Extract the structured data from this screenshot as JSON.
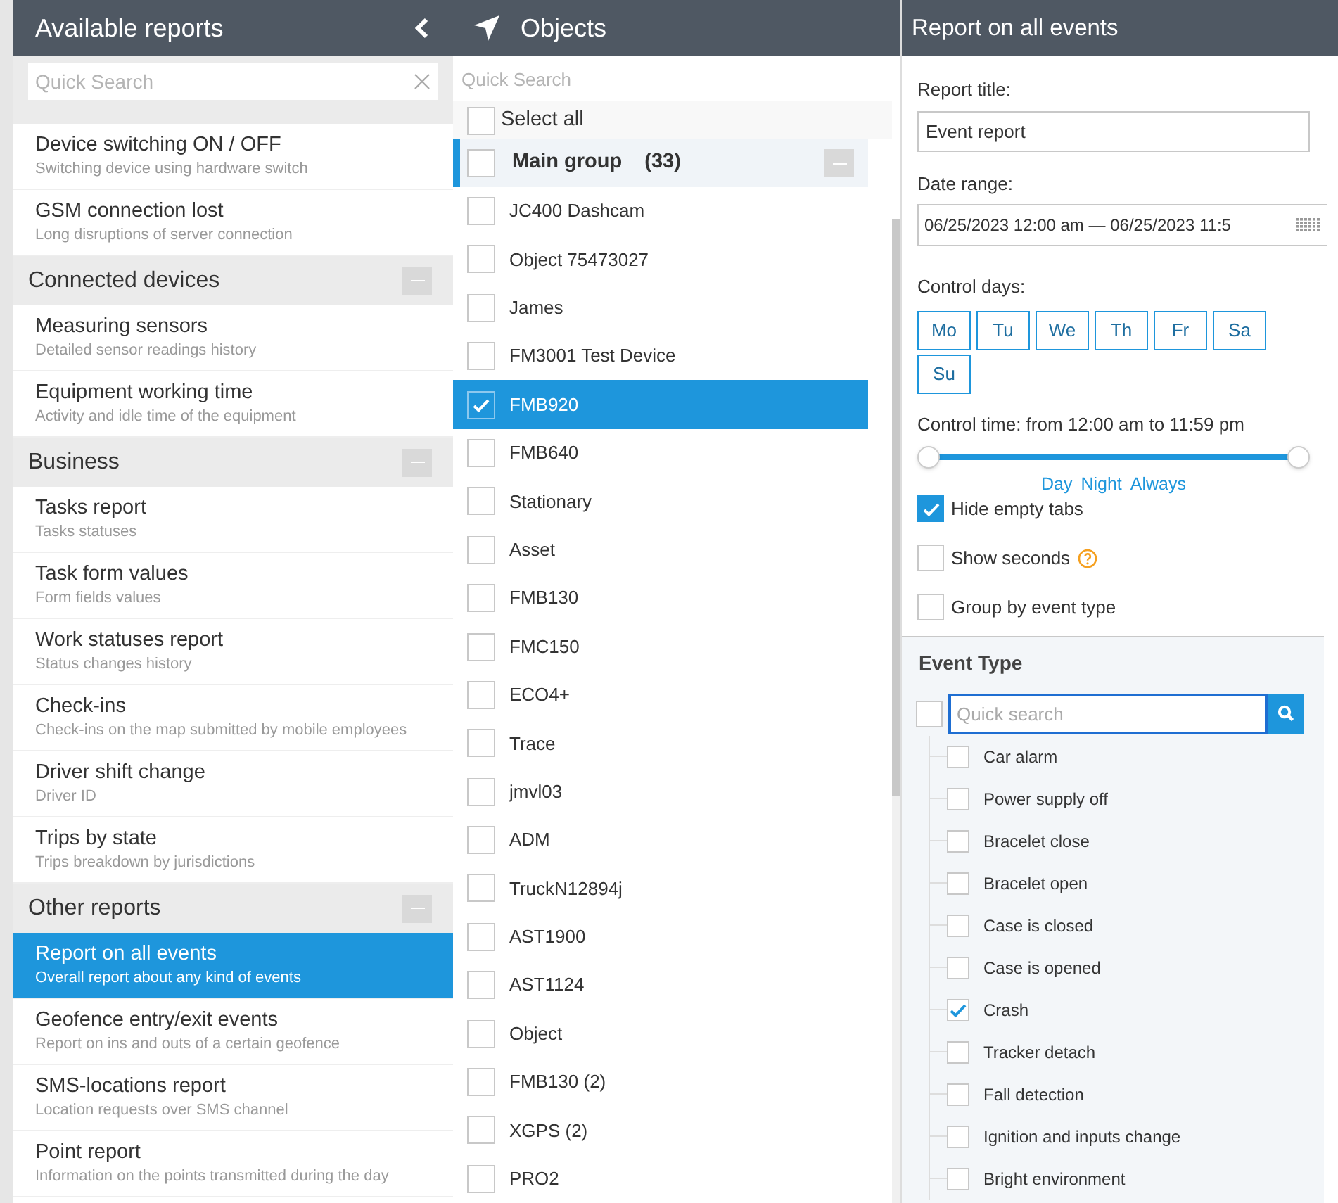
{
  "reports_panel": {
    "title": "Available reports",
    "search": {
      "placeholder": "Quick Search"
    },
    "sections": [
      {
        "items": [
          {
            "title": "Device switching ON / OFF",
            "subtitle": "Switching device using hardware switch",
            "selected": false
          },
          {
            "title": "GSM connection lost",
            "subtitle": "Long disruptions of server connection",
            "selected": false
          }
        ]
      },
      {
        "title": "Connected devices",
        "items": [
          {
            "title": "Measuring sensors",
            "subtitle": "Detailed sensor readings history",
            "selected": false
          },
          {
            "title": "Equipment working time",
            "subtitle": "Activity and idle time of the equipment",
            "selected": false
          }
        ]
      },
      {
        "title": "Business",
        "items": [
          {
            "title": "Tasks report",
            "subtitle": "Tasks statuses",
            "selected": false
          },
          {
            "title": "Task form values",
            "subtitle": "Form fields values",
            "selected": false
          },
          {
            "title": "Work statuses report",
            "subtitle": "Status changes history",
            "selected": false
          },
          {
            "title": "Check-ins",
            "subtitle": "Check-ins on the map submitted by mobile employees",
            "selected": false
          },
          {
            "title": "Driver shift change",
            "subtitle": "Driver ID",
            "selected": false
          },
          {
            "title": "Trips by state",
            "subtitle": "Trips breakdown by jurisdictions",
            "selected": false
          }
        ]
      },
      {
        "title": "Other reports",
        "items": [
          {
            "title": "Report on all events",
            "subtitle": "Overall report about any kind of events",
            "selected": true
          },
          {
            "title": "Geofence entry/exit events",
            "subtitle": "Report on ins and outs of a certain geofence",
            "selected": false
          },
          {
            "title": "SMS-locations report",
            "subtitle": "Location requests over SMS channel",
            "selected": false
          },
          {
            "title": "Point report",
            "subtitle": "Information on the points transmitted during the day",
            "selected": false
          }
        ]
      }
    ]
  },
  "objects_panel": {
    "title": "Objects",
    "search": {
      "placeholder": "Quick Search"
    },
    "select_all": {
      "label": "Select all",
      "checked": false
    },
    "group": {
      "name": "Main group",
      "count": "(33)",
      "checked": false
    },
    "objects": [
      {
        "name": "JC400 Dashcam",
        "checked": false
      },
      {
        "name": "Object 75473027",
        "checked": false
      },
      {
        "name": "James",
        "checked": false
      },
      {
        "name": "FM3001 Test Device",
        "checked": false
      },
      {
        "name": "FMB920",
        "checked": true
      },
      {
        "name": "FMB640",
        "checked": false
      },
      {
        "name": "Stationary",
        "checked": false
      },
      {
        "name": "Asset",
        "checked": false
      },
      {
        "name": "FMB130",
        "checked": false
      },
      {
        "name": "FMC150",
        "checked": false
      },
      {
        "name": "ECO4+",
        "checked": false
      },
      {
        "name": "Trace",
        "checked": false
      },
      {
        "name": "jmvl03",
        "checked": false
      },
      {
        "name": "ADM",
        "checked": false
      },
      {
        "name": "TruckN12894j",
        "checked": false
      },
      {
        "name": "AST1900",
        "checked": false
      },
      {
        "name": "AST1124",
        "checked": false
      },
      {
        "name": "Object",
        "checked": false
      },
      {
        "name": "FMB130 (2)",
        "checked": false
      },
      {
        "name": "XGPS (2)",
        "checked": false
      },
      {
        "name": "PRO2",
        "checked": false
      }
    ]
  },
  "report_panel": {
    "title": "Report on all events",
    "report_title": {
      "label": "Report title:",
      "value": "Event report"
    },
    "date_range": {
      "label": "Date range:",
      "value": "06/25/2023 12:00 am — 06/25/2023 11:5"
    },
    "control_days": {
      "label": "Control days:",
      "days": [
        {
          "label": "Mo",
          "selected": true
        },
        {
          "label": "Tu",
          "selected": true
        },
        {
          "label": "We",
          "selected": true
        },
        {
          "label": "Th",
          "selected": true
        },
        {
          "label": "Fr",
          "selected": true
        },
        {
          "label": "Sa",
          "selected": true
        },
        {
          "label": "Su",
          "selected": true
        }
      ]
    },
    "control_time": {
      "label": "Control time: from 12:00 am to 11:59 pm",
      "handles": [
        {
          "level": 0
        },
        {
          "level": 1
        }
      ],
      "presets": [
        "Day",
        "Night",
        "Always"
      ]
    },
    "options": [
      {
        "label": "Hide empty tabs",
        "checked": true,
        "help": false
      },
      {
        "label": "Show seconds",
        "checked": false,
        "help": true
      },
      {
        "label": "Group by event type",
        "checked": false,
        "help": false
      }
    ],
    "event_type": {
      "title": "Event Type",
      "all_checked": false,
      "search": {
        "placeholder": "Quick search"
      },
      "events": [
        {
          "name": "Car alarm",
          "checked": false
        },
        {
          "name": "Power supply off",
          "checked": false
        },
        {
          "name": "Bracelet close",
          "checked": false
        },
        {
          "name": "Bracelet open",
          "checked": false
        },
        {
          "name": "Case is closed",
          "checked": false
        },
        {
          "name": "Case is opened",
          "checked": false
        },
        {
          "name": "Crash",
          "checked": true
        },
        {
          "name": "Tracker detach",
          "checked": false
        },
        {
          "name": "Fall detection",
          "checked": false
        },
        {
          "name": "Ignition and inputs change",
          "checked": false
        },
        {
          "name": "Bright environment",
          "checked": false
        }
      ]
    }
  }
}
